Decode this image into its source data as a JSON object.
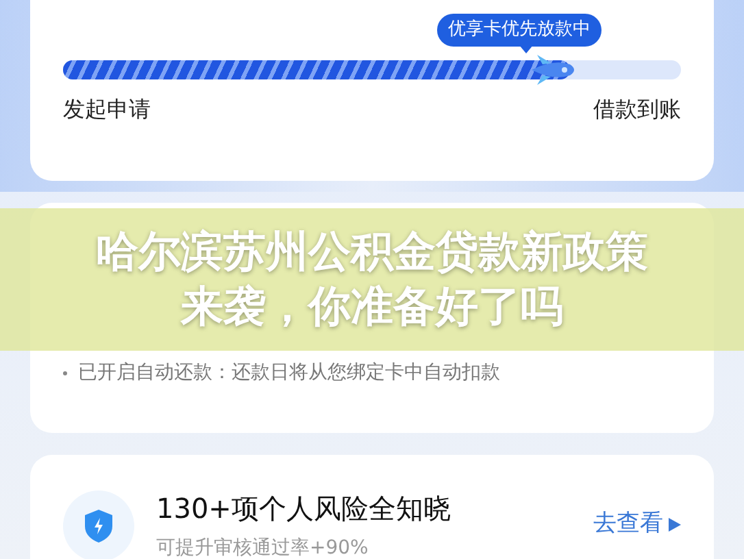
{
  "progress_card": {
    "badge": "优享卡优先放款中",
    "level": 0.82,
    "start_label": "发起申请",
    "end_label": "借款到账"
  },
  "reminder_card": {
    "items": [
      "已开启自动还款：还款日将从您绑定卡中自动扣款"
    ]
  },
  "risk_card": {
    "title": "130+项个人风险全知晓",
    "subtitle": "可提升审核通过率+90%",
    "action": "去查看"
  },
  "headline": {
    "lines": [
      "哈尔滨苏州公积金贷款新政策",
      "来袭，你准备好了吗"
    ]
  }
}
